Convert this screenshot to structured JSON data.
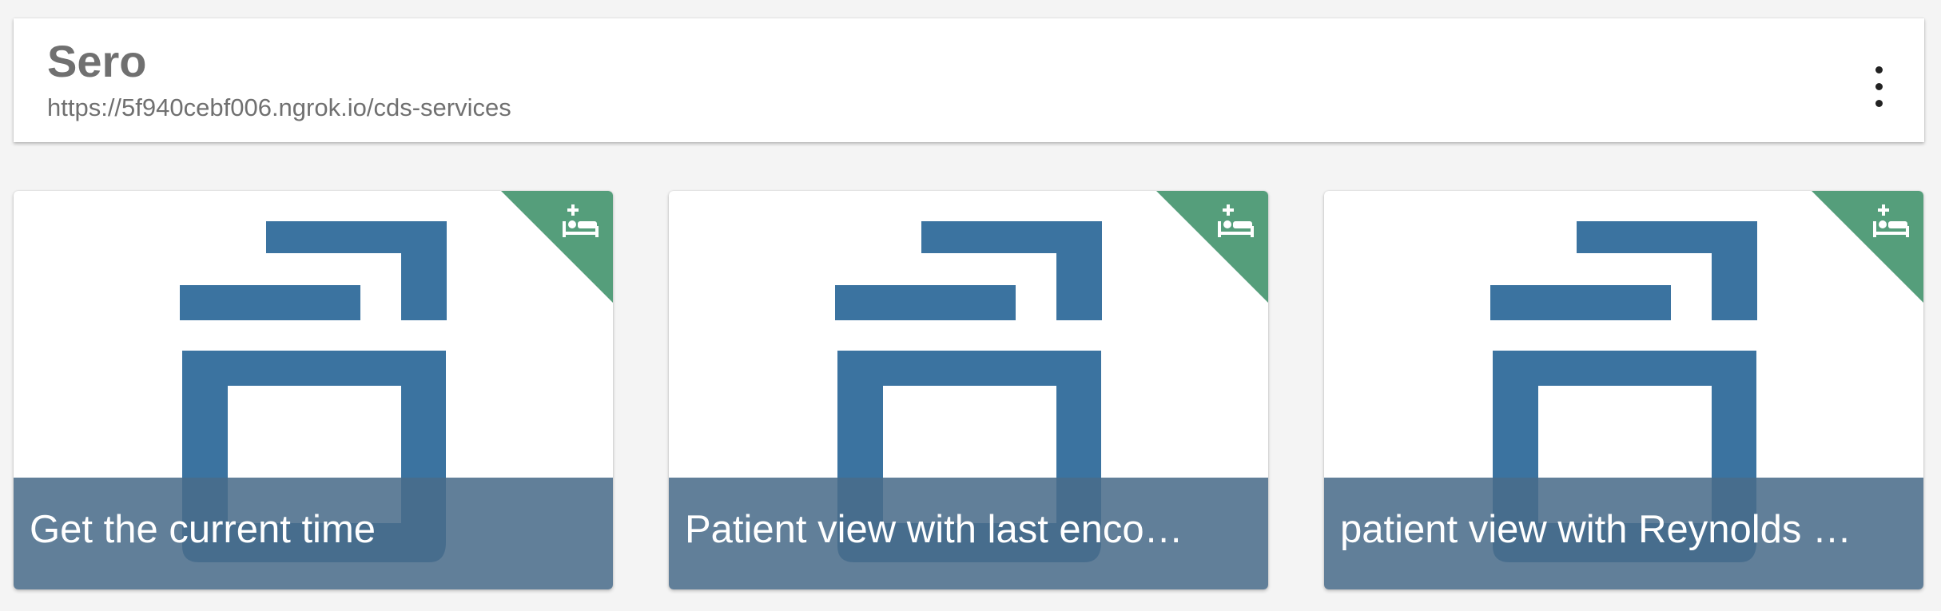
{
  "header": {
    "title": "Sero",
    "url": "https://5f940cebf006.ngrok.io/cds-services",
    "menu_icon": "more-vert-icon"
  },
  "cards": [
    {
      "title": "Get the current time",
      "badge_icon": "hospital-bed-icon",
      "logo_icon": "service-logo-icon"
    },
    {
      "title": "Patient view with last enco…",
      "badge_icon": "hospital-bed-icon",
      "logo_icon": "service-logo-icon"
    },
    {
      "title": "patient view with Reynolds …",
      "badge_icon": "hospital-bed-icon",
      "logo_icon": "service-logo-icon"
    }
  ],
  "colors": {
    "background": "#f4f4f4",
    "logo_blue": "#3b73a0",
    "badge_green": "#559e7b",
    "caption_overlay": "#4a6c8a",
    "text_gray": "#707070"
  }
}
